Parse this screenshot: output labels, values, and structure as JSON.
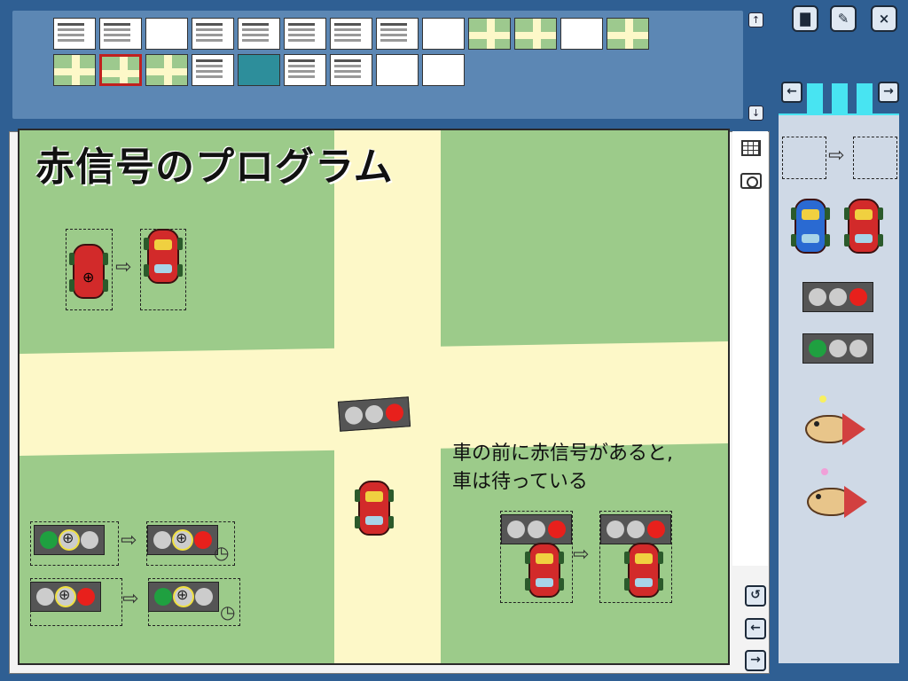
{
  "stage": {
    "title": "赤信号のプログラム",
    "caption_line1": "車の前に赤信号があると,",
    "caption_line2": "車は待っている"
  },
  "strip": {
    "scroll_up": "↑",
    "scroll_down": "↓"
  },
  "toolbar": {
    "paint_icon": "paint-bucket-icon",
    "brush_icon": "brush-icon",
    "close_label": "×"
  },
  "palette": {
    "prev_label": "←",
    "next_label": "→"
  },
  "stage_tools": {
    "grid_icon": "grid-icon",
    "camera_icon": "camera-icon"
  },
  "bottom_nav": {
    "undo_label": "↺",
    "back_label": "←",
    "forward_label": "→"
  },
  "colors": {
    "background": "#2f5f93",
    "grass": "#9ccb8a",
    "road": "#fdf8c8",
    "palette": "#cfd9e6",
    "selected_thumb": "#c0201e"
  }
}
